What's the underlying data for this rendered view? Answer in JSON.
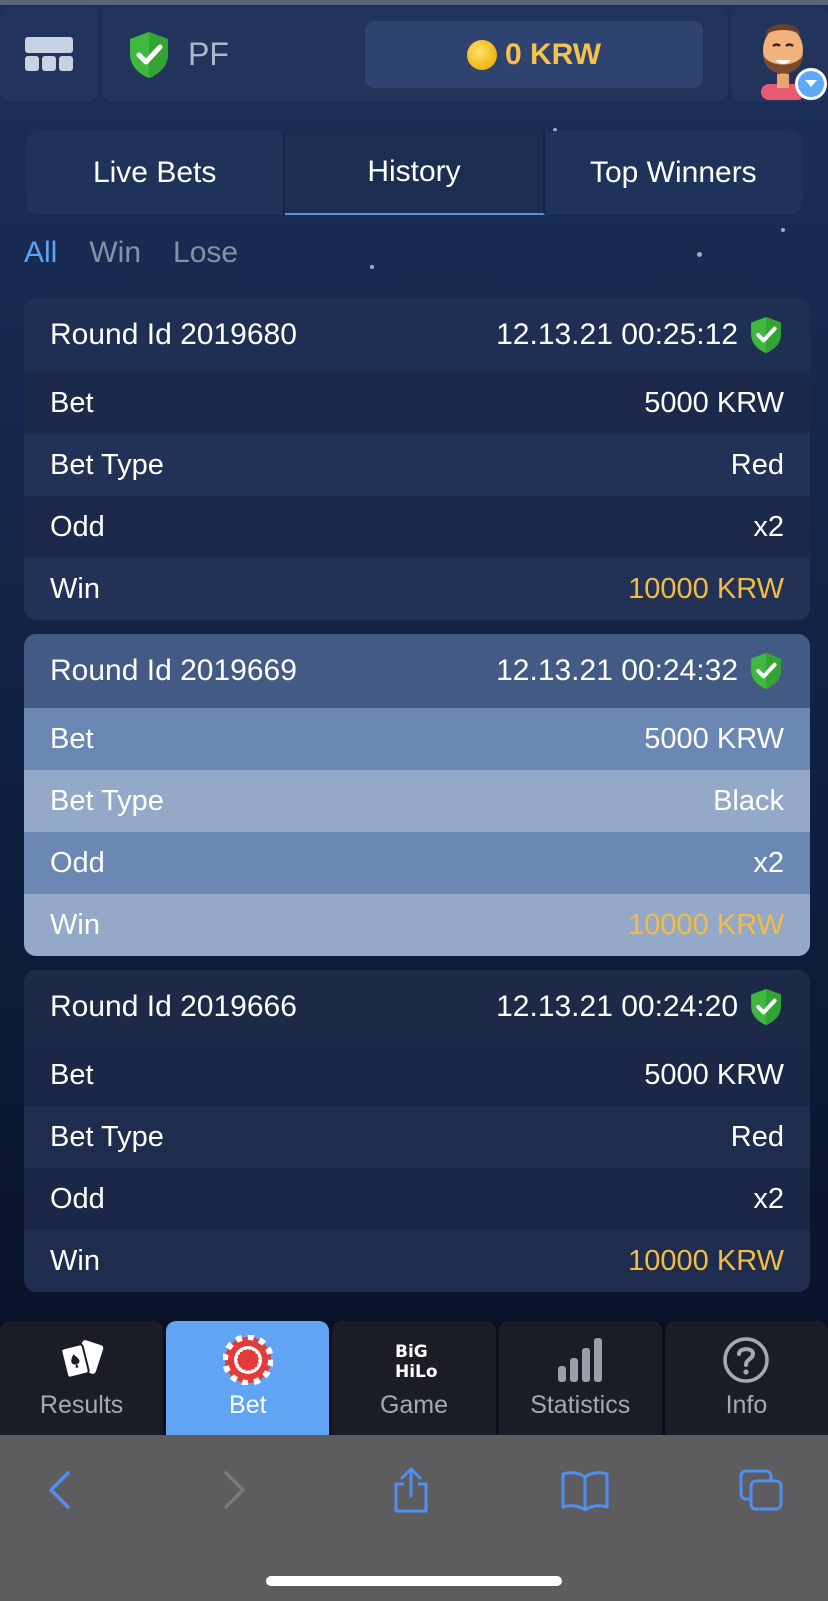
{
  "header": {
    "pf_label": "PF",
    "balance": "0 KRW"
  },
  "tabs": [
    {
      "label": "Live Bets",
      "active": false
    },
    {
      "label": "History",
      "active": true
    },
    {
      "label": "Top Winners",
      "active": false
    }
  ],
  "filters": [
    {
      "label": "All",
      "active": true
    },
    {
      "label": "Win",
      "active": false
    },
    {
      "label": "Lose",
      "active": false
    }
  ],
  "rounds": [
    {
      "round": "Round Id 2019680",
      "datetime": "12.13.21 00:25:12",
      "bet_label": "Bet",
      "bet": "5000 KRW",
      "type_label": "Bet Type",
      "type": "Red",
      "odd_label": "Odd",
      "odd": "x2",
      "win_label": "Win",
      "win": "10000 KRW"
    },
    {
      "round": "Round Id 2019669",
      "datetime": "12.13.21 00:24:32",
      "bet_label": "Bet",
      "bet": "5000 KRW",
      "type_label": "Bet Type",
      "type": "Black",
      "odd_label": "Odd",
      "odd": "x2",
      "win_label": "Win",
      "win": "10000 KRW"
    },
    {
      "round": "Round Id 2019666",
      "datetime": "12.13.21 00:24:20",
      "bet_label": "Bet",
      "bet": "5000 KRW",
      "type_label": "Bet Type",
      "type": "Red",
      "odd_label": "Odd",
      "odd": "x2",
      "win_label": "Win",
      "win": "10000 KRW"
    }
  ],
  "bottom_nav": [
    {
      "label": "Results",
      "icon": "cards-icon"
    },
    {
      "label": "Bet",
      "icon": "chip-icon",
      "active": true
    },
    {
      "label": "Game",
      "icon": "big-hilo-logo"
    },
    {
      "label": "Statistics",
      "icon": "bar-chart-icon"
    },
    {
      "label": "Info",
      "icon": "question-icon"
    }
  ],
  "colors": {
    "accent": "#61a4f3",
    "win": "#f6bc42",
    "shield": "#3fb83f"
  }
}
